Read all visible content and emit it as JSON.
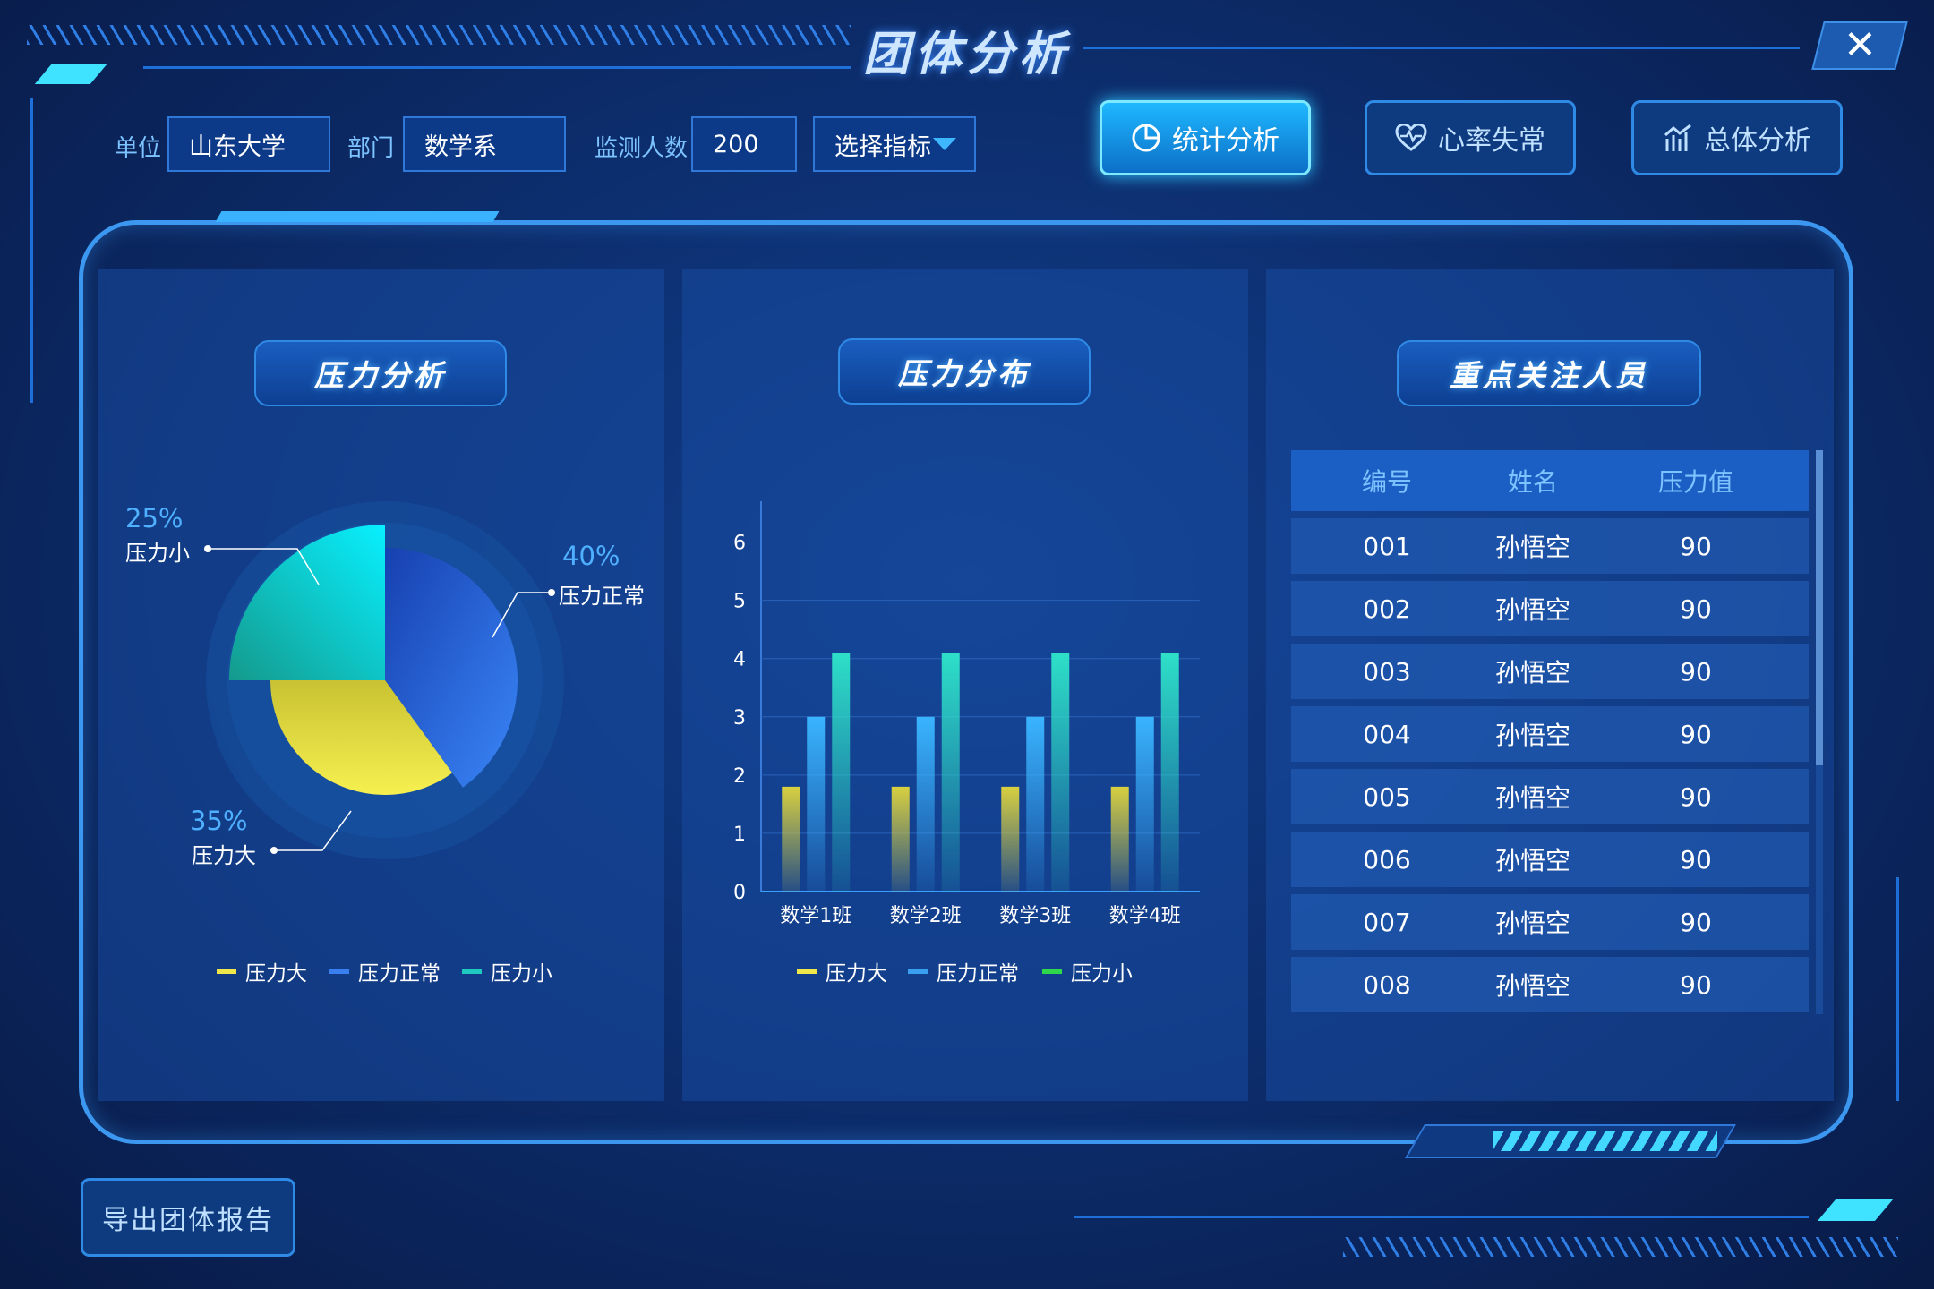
{
  "header": {
    "title": "团体分析",
    "close": "✕"
  },
  "filters": {
    "unit_label": "单位",
    "unit_value": "山东大学",
    "dept_label": "部门",
    "dept_value": "数学系",
    "count_label": "监测人数",
    "count_value": "200",
    "metric_select": "选择指标"
  },
  "tabs": [
    {
      "label": "统计分析",
      "icon": "pie-chart-icon",
      "active": true
    },
    {
      "label": "心率失常",
      "icon": "heart-pulse-icon",
      "active": false
    },
    {
      "label": "总体分析",
      "icon": "bar-trend-icon",
      "active": false
    }
  ],
  "panels": {
    "pressure_analysis": "压力分析",
    "pressure_distribution": "压力分布",
    "key_persons": "重点关注人员"
  },
  "colors": {
    "big": "#f0e84a",
    "normal": "#3a7ff0",
    "small": "#1fc9c0",
    "accent": "#3fe3ff"
  },
  "chart_data": [
    {
      "type": "pie",
      "slices": [
        {
          "name": "压力大",
          "value": 35,
          "label": "35%"
        },
        {
          "name": "压力正常",
          "value": 40,
          "label": "40%"
        },
        {
          "name": "压力小",
          "value": 25,
          "label": "25%"
        }
      ],
      "legend": [
        "压力大",
        "压力正常",
        "压力小"
      ]
    },
    {
      "type": "bar",
      "categories": [
        "数学1班",
        "数学2班",
        "数学3班",
        "数学4班"
      ],
      "series": [
        {
          "name": "压力大",
          "values": [
            1.8,
            1.8,
            1.8,
            1.8
          ]
        },
        {
          "name": "压力正常",
          "values": [
            3,
            3,
            3,
            3
          ]
        },
        {
          "name": "压力小",
          "values": [
            4.1,
            4.1,
            4.1,
            4.1
          ]
        }
      ],
      "yticks": [
        "0",
        "1",
        "2",
        "3",
        "4",
        "5",
        "6"
      ],
      "ylim": [
        0,
        6.7
      ],
      "legend": [
        "压力大",
        "压力正常",
        "压力小"
      ]
    }
  ],
  "table": {
    "headers": [
      "编号",
      "姓名",
      "压力值"
    ],
    "rows": [
      [
        "001",
        "孙悟空",
        "90"
      ],
      [
        "002",
        "孙悟空",
        "90"
      ],
      [
        "003",
        "孙悟空",
        "90"
      ],
      [
        "004",
        "孙悟空",
        "90"
      ],
      [
        "005",
        "孙悟空",
        "90"
      ],
      [
        "006",
        "孙悟空",
        "90"
      ],
      [
        "007",
        "孙悟空",
        "90"
      ],
      [
        "008",
        "孙悟空",
        "90"
      ]
    ]
  },
  "footer": {
    "export_label": "导出团体报告"
  }
}
